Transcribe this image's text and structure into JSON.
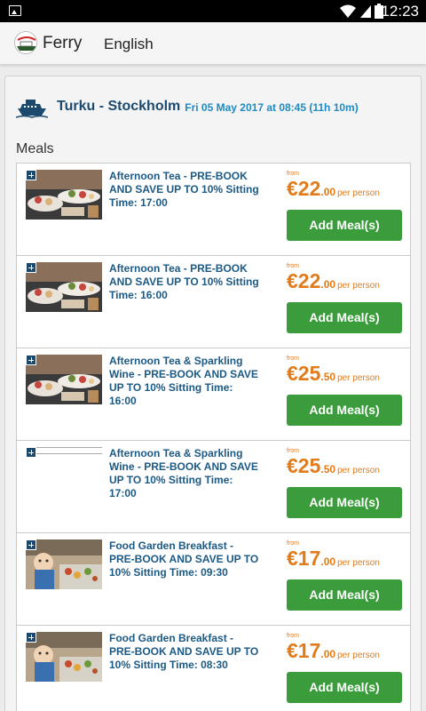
{
  "status_bar": {
    "time": "12:23",
    "icons": [
      "gallery-icon",
      "wifi-icon",
      "signal-icon",
      "battery-icon"
    ]
  },
  "app_bar": {
    "title": "Ferry",
    "language": "English"
  },
  "route": {
    "name": "Turku - Stockholm",
    "meta": "Fri 05 May 2017 at 08:45 (11h 10m)"
  },
  "section_title": "Meals",
  "colors": {
    "accent_blue": "#1c4a6e",
    "link_blue": "#1b5a85",
    "price_orange": "#e07c1c",
    "button_green": "#3b9c3b"
  },
  "meals": [
    {
      "name": "Afternoon Tea - PRE-BOOK AND SAVE UP TO 10% Sitting Time: 17:00",
      "from": "from",
      "price_int": "€22",
      "price_dec": ".00",
      "unit": "per person",
      "button": "Add Meal(s)",
      "image": "afternoon-tea"
    },
    {
      "name": "Afternoon Tea - PRE-BOOK AND SAVE UP TO 10% Sitting Time: 16:00",
      "from": "from",
      "price_int": "€22",
      "price_dec": ".00",
      "unit": "per person",
      "button": "Add Meal(s)",
      "image": "afternoon-tea"
    },
    {
      "name": "Afternoon Tea & Sparkling Wine - PRE-BOOK AND SAVE UP TO 10% Sitting Time: 16:00",
      "from": "from",
      "price_int": "€25",
      "price_dec": ".50",
      "unit": "per person",
      "button": "Add Meal(s)",
      "image": "afternoon-tea"
    },
    {
      "name": "Afternoon Tea & Sparkling Wine - PRE-BOOK AND SAVE UP TO 10% Sitting Time: 17:00",
      "from": "from",
      "price_int": "€25",
      "price_dec": ".50",
      "unit": "per person",
      "button": "Add Meal(s)",
      "image": "none"
    },
    {
      "name": "Food Garden Breakfast - PRE-BOOK AND SAVE UP TO 10% Sitting Time: 09:30",
      "from": "from",
      "price_int": "€17",
      "price_dec": ".00",
      "unit": "per person",
      "button": "Add Meal(s)",
      "image": "breakfast"
    },
    {
      "name": "Food Garden Breakfast - PRE-BOOK AND SAVE UP TO 10% Sitting Time: 08:30",
      "from": "from",
      "price_int": "€17",
      "price_dec": ".00",
      "unit": "per person",
      "button": "Add Meal(s)",
      "image": "breakfast"
    }
  ]
}
